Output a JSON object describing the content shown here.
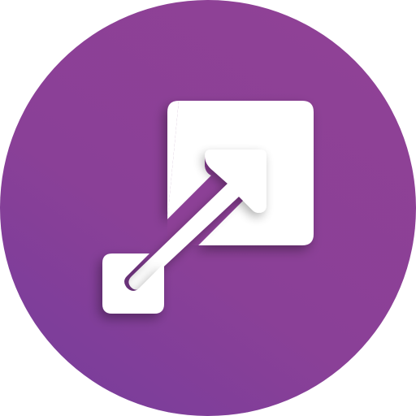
{
  "icon": {
    "name": "resize-enlarge-app-icon",
    "description_symbol": "small-square-to-large-square-arrow",
    "colors": {
      "circle_top": "#8E4196",
      "circle_bottom": "#7B3C9A",
      "glyph": "#FFFFFF",
      "shadow": "#5E2A6B"
    }
  }
}
